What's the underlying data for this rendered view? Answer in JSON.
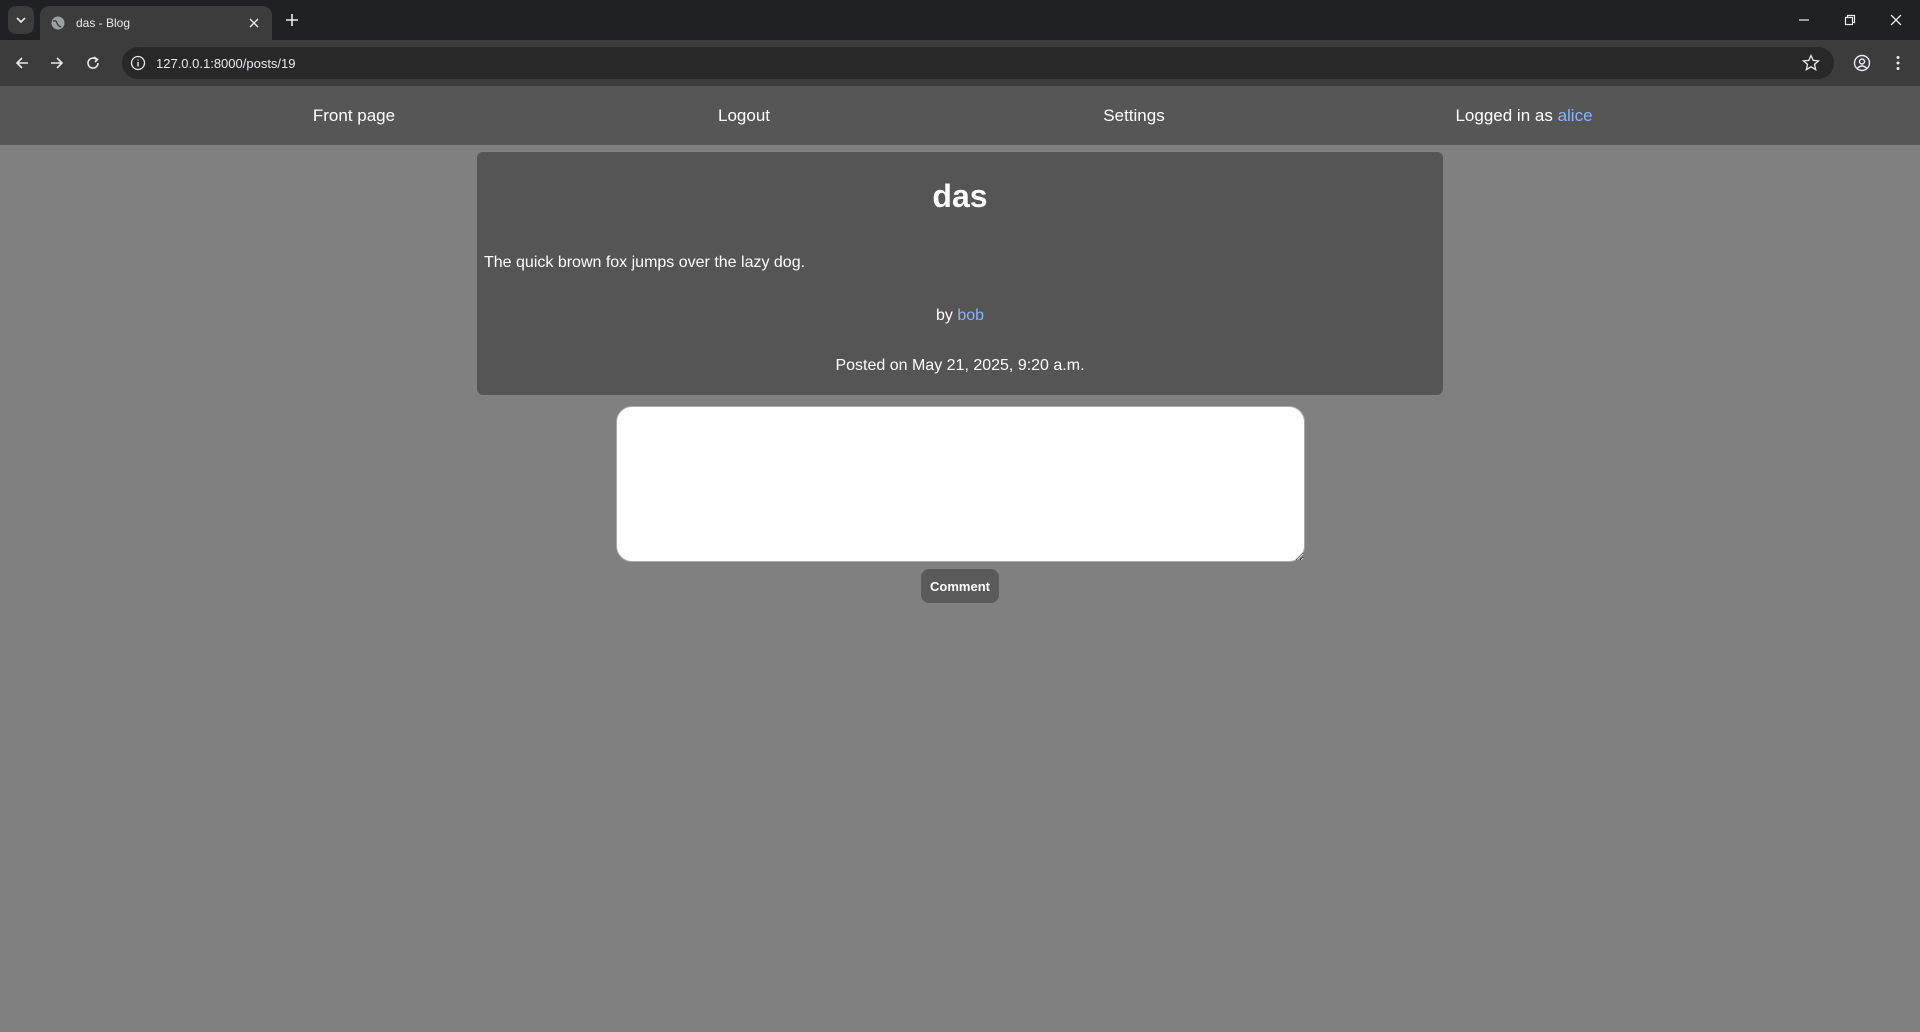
{
  "browser": {
    "tab_title": "das - Blog",
    "url": "127.0.0.1:8000/posts/19"
  },
  "nav": {
    "front_page": "Front page",
    "logout": "Logout",
    "settings": "Settings",
    "logged_in_prefix": "Logged in as ",
    "username": "alice"
  },
  "post": {
    "title": "das",
    "body": "The quick brown fox jumps over the lazy dog.",
    "by_prefix": "by ",
    "author": "bob",
    "posted_on": "Posted on May 21, 2025, 9:20 a.m."
  },
  "comment": {
    "button_label": "Comment"
  },
  "colors": {
    "page_bg": "#808080",
    "nav_bg": "#565656",
    "card_bg": "#555555",
    "link": "#8ab4f8"
  }
}
